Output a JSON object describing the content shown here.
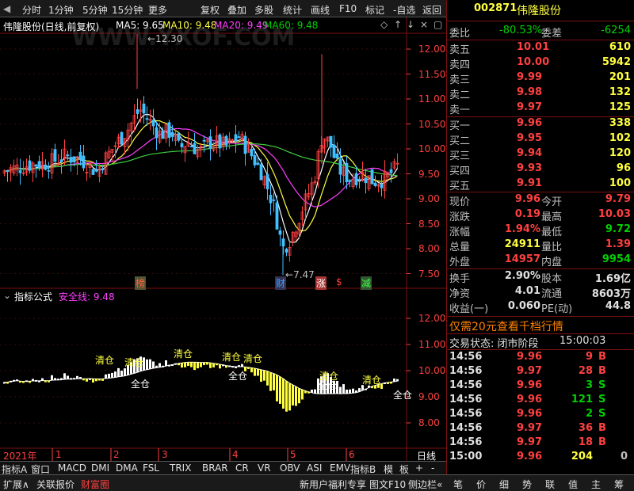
{
  "toolbar": {
    "items": [
      "分时",
      "1分钟",
      "5分钟",
      "15分钟",
      "更多",
      "复权",
      "叠加",
      "多股",
      "统计",
      "画线",
      "F10",
      "标记",
      "-自选",
      "返回"
    ]
  },
  "stock": {
    "code": "002871",
    "name": "伟隆股份"
  },
  "chart_header": {
    "title": "伟隆股份(日线,前复权)",
    "ma5": "MA5: 9.65",
    "ma10": "MA10: 9.48",
    "ma20": "MA20: 9.49",
    "ma60": "MA60: 9.48"
  },
  "watermark": "WWW.YXOF.COM",
  "price_axis": [
    "12.00",
    "11.50",
    "11.00",
    "10.50",
    "10.00",
    "9.50",
    "9.00",
    "8.50",
    "8.00",
    "7.50"
  ],
  "high_label": "12.30",
  "low_label": "7.47",
  "events": [
    "榜",
    "财",
    "涨",
    "$",
    "减"
  ],
  "indicator": {
    "title": "指标公式",
    "line_label": "安全线: 9.48",
    "axis": [
      "12.00",
      "11.00",
      "10.00",
      "9.00",
      "8.00"
    ],
    "buy_labels": [
      "清仓",
      "清仓",
      "清仓",
      "清仓",
      "清仓",
      "清仓",
      "清仓"
    ],
    "sell_labels": [
      "全仓",
      "全仓",
      "全仓",
      "全仓"
    ]
  },
  "time_axis": {
    "labels": [
      "2021年",
      "1",
      "2",
      "3",
      "4",
      "5",
      "6"
    ],
    "period": "日线"
  },
  "indicator_tabs": [
    "指标A",
    "窗口",
    "MACD",
    "DMI",
    "DMA",
    "FSL",
    "TRIX",
    "BRAR",
    "CR",
    "VR",
    "OBV",
    "ASI",
    "EMV",
    "指标B",
    "模",
    "板",
    "+",
    "-"
  ],
  "quote": {
    "weibi_label": "委比",
    "weibi": "-80.53%",
    "weicha_label": "委差",
    "weicha": "-6254",
    "sells": [
      {
        "label": "卖五",
        "price": "10.01",
        "vol": "610"
      },
      {
        "label": "卖四",
        "price": "10.00",
        "vol": "5942"
      },
      {
        "label": "卖三",
        "price": "9.99",
        "vol": "201"
      },
      {
        "label": "卖二",
        "price": "9.98",
        "vol": "132"
      },
      {
        "label": "卖一",
        "price": "9.97",
        "vol": "125"
      }
    ],
    "buys": [
      {
        "label": "买一",
        "price": "9.96",
        "vol": "338"
      },
      {
        "label": "买二",
        "price": "9.95",
        "vol": "102"
      },
      {
        "label": "买三",
        "price": "9.94",
        "vol": "120"
      },
      {
        "label": "买四",
        "price": "9.93",
        "vol": "96"
      },
      {
        "label": "买五",
        "price": "9.91",
        "vol": "100"
      }
    ],
    "stats": [
      {
        "l1": "现价",
        "v1": "9.96",
        "l2": "今开",
        "v2": "9.79"
      },
      {
        "l1": "涨跌",
        "v1": "0.19",
        "l2": "最高",
        "v2": "10.03"
      },
      {
        "l1": "涨幅",
        "v1": "1.94%",
        "l2": "最低",
        "v2": "9.72"
      },
      {
        "l1": "总量",
        "v1": "24911",
        "l2": "量比",
        "v2": "1.39"
      },
      {
        "l1": "外盘",
        "v1": "14957",
        "l2": "内盘",
        "v2": "9954"
      }
    ],
    "stats2": [
      {
        "l1": "换手",
        "v1": "2.90%",
        "l2": "股本",
        "v2": "1.69亿"
      },
      {
        "l1": "净资",
        "v1": "4.01",
        "l2": "流通",
        "v2": "8603万"
      },
      {
        "l1": "收益(一)",
        "v1": "0.060",
        "l2": "PE(动)",
        "v2": "44.8"
      }
    ],
    "promo": "仅需20元查看千档行情",
    "status_label": "交易状态: 闭市阶段",
    "status_time": "15:00:03",
    "ticks": [
      {
        "t": "14:56",
        "p": "9.96",
        "v": "9",
        "d": "B"
      },
      {
        "t": "14:56",
        "p": "9.97",
        "v": "28",
        "d": "B"
      },
      {
        "t": "14:56",
        "p": "9.96",
        "v": "3",
        "d": "S"
      },
      {
        "t": "14:56",
        "p": "9.96",
        "v": "121",
        "d": "S"
      },
      {
        "t": "14:56",
        "p": "9.96",
        "v": "2",
        "d": "S"
      },
      {
        "t": "14:56",
        "p": "9.97",
        "v": "36",
        "d": "B"
      },
      {
        "t": "14:56",
        "p": "9.97",
        "v": "18",
        "d": "B"
      },
      {
        "t": "15:00",
        "p": "9.96",
        "v": "204",
        "d": "0"
      }
    ]
  },
  "bottom": {
    "left": [
      "扩展∧",
      "关联报价",
      "财富圈"
    ],
    "mid": [
      "新用户福利专享",
      "图文F10",
      "侧边栏«"
    ],
    "right": [
      "笔",
      "价",
      "细",
      "势",
      "联",
      "值",
      "主",
      "筹"
    ]
  }
}
